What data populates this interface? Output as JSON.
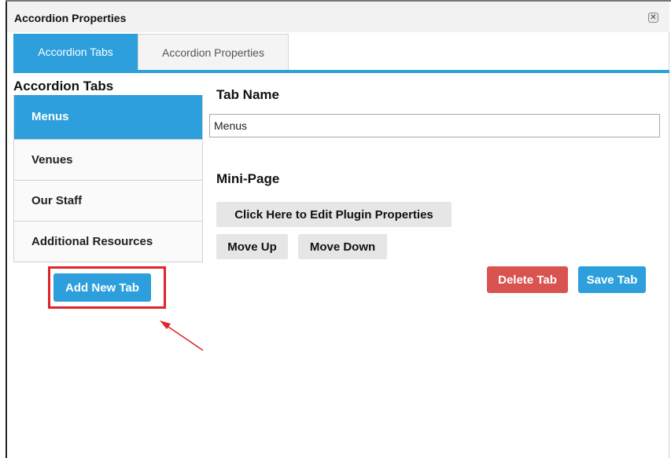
{
  "dialog": {
    "title": "Accordion Properties",
    "close_icon": "close-icon"
  },
  "tabs": [
    {
      "label": "Accordion Tabs",
      "active": true
    },
    {
      "label": "Accordion Properties",
      "active": false
    }
  ],
  "sidebar": {
    "heading": "Accordion Tabs",
    "items": [
      {
        "label": "Menus",
        "active": true
      },
      {
        "label": "Venues",
        "active": false
      },
      {
        "label": "Our Staff",
        "active": false
      },
      {
        "label": "Additional Resources",
        "active": false
      }
    ],
    "add_button": "Add New Tab"
  },
  "editor": {
    "tab_name_label": "Tab Name",
    "tab_name_value": "Menus",
    "mini_page_label": "Mini-Page",
    "edit_plugin_button": "Click Here to Edit Plugin Properties",
    "move_up_button": "Move Up",
    "move_down_button": "Move Down",
    "delete_button": "Delete Tab",
    "save_button": "Save Tab"
  },
  "colors": {
    "accent": "#2c9fdc",
    "danger": "#d9534f",
    "annotation": "#e0242b"
  }
}
